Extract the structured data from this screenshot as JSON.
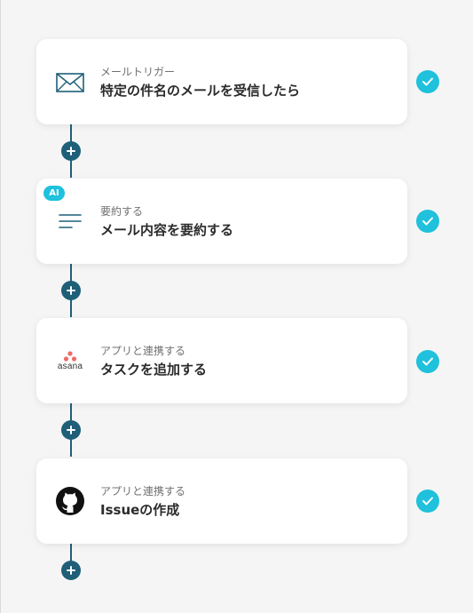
{
  "steps": [
    {
      "subtitle": "メールトリガー",
      "title": "特定の件名のメールを受信したら",
      "icon": "mail-icon"
    },
    {
      "subtitle": "要約する",
      "title": "メール内容を要約する",
      "icon": "summary-lines-icon",
      "badge": "AI"
    },
    {
      "subtitle": "アプリと連携する",
      "title": "タスクを追加する",
      "icon": "asana-logo",
      "logo_text": "asana"
    },
    {
      "subtitle": "アプリと連携する",
      "title": "Issueの作成",
      "icon": "github-icon"
    }
  ],
  "colors": {
    "connector": "#1f5f78",
    "check": "#1fc1dc",
    "badge": "#1fc1dc",
    "asana_red": "#f06a6a"
  }
}
